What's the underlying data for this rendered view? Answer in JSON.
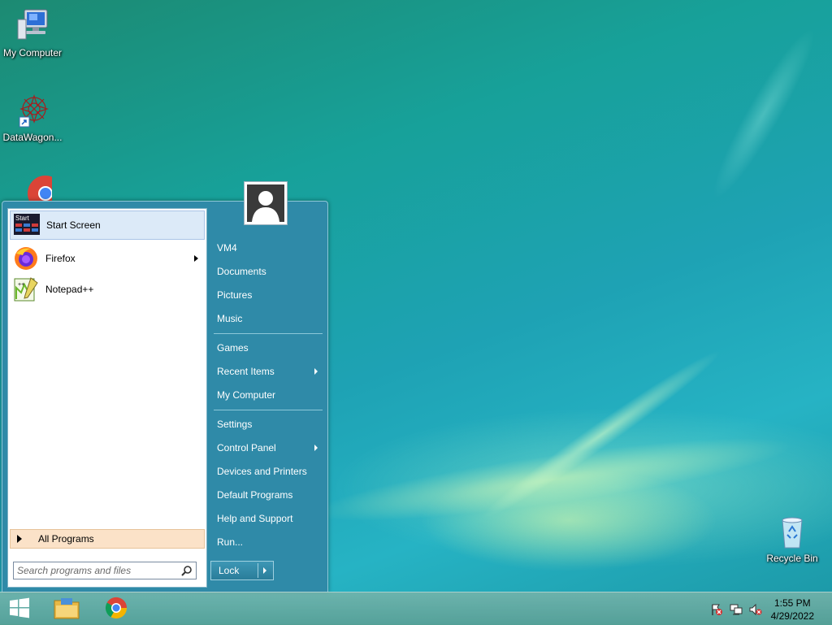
{
  "desktop": {
    "icons": [
      {
        "label": "My Computer",
        "icon": "computer-icon"
      },
      {
        "label": "DataWagon...",
        "icon": "datawagon-icon"
      },
      {
        "label": "",
        "icon": "chrome-icon"
      },
      {
        "label": "Recycle Bin",
        "icon": "recycle-bin-icon"
      }
    ]
  },
  "start_menu": {
    "programs": [
      {
        "label": "Start Screen",
        "icon": "start-screen-icon",
        "selected": true
      },
      {
        "label": "Firefox",
        "icon": "firefox-icon",
        "has_submenu": true
      },
      {
        "label": "Notepad++",
        "icon": "notepadpp-icon"
      }
    ],
    "all_programs_label": "All Programs",
    "search": {
      "placeholder": "Search programs and files",
      "value": ""
    },
    "right_items": [
      {
        "label": "VM4"
      },
      {
        "label": "Documents"
      },
      {
        "label": "Pictures"
      },
      {
        "label": "Music"
      },
      {
        "label": "Games"
      },
      {
        "label": "Recent Items",
        "has_submenu": true
      },
      {
        "label": "My Computer"
      },
      {
        "label": "Settings"
      },
      {
        "label": "Control Panel",
        "has_submenu": true
      },
      {
        "label": "Devices and Printers"
      },
      {
        "label": "Default Programs"
      },
      {
        "label": "Help and Support"
      },
      {
        "label": "Run..."
      }
    ],
    "lock_label": "Lock"
  },
  "taskbar": {
    "pinned": [
      "windows-start-icon",
      "file-explorer-icon",
      "chrome-icon"
    ],
    "tray": [
      "action-center-flag-icon",
      "network-icon",
      "volume-muted-icon"
    ],
    "time": "1:55 PM",
    "date": "4/29/2022"
  },
  "colors": {
    "menu_blue": "#2f8aa8",
    "selected_bg": "#dceaf8",
    "all_programs_bg": "#fbe2c8"
  }
}
